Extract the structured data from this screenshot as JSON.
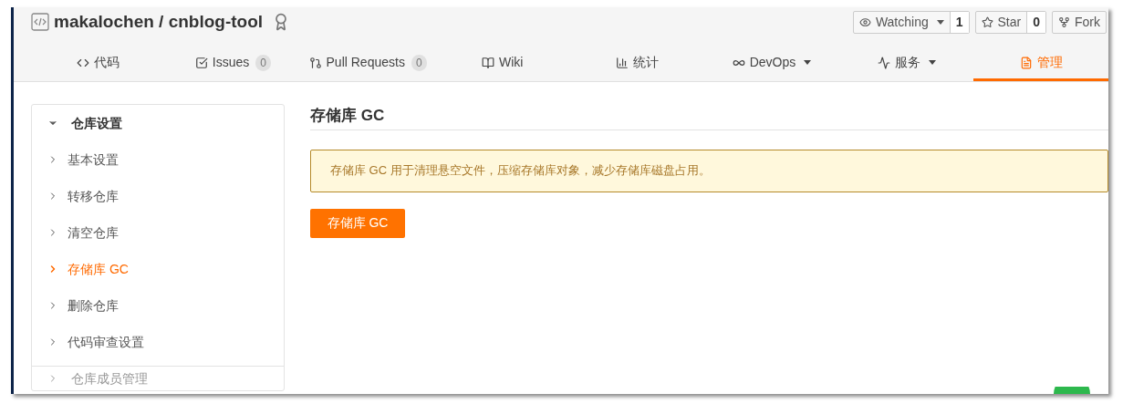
{
  "repo": {
    "title": "makalochen / cnblog-tool"
  },
  "repo_actions": [
    {
      "kind": "watch",
      "label": "Watching",
      "count": "1",
      "dropdown": true
    },
    {
      "kind": "star",
      "label": "Star",
      "count": "0",
      "dropdown": false
    },
    {
      "kind": "fork",
      "label": "Fork",
      "dropdown": false
    }
  ],
  "tabs": [
    {
      "kind": "code",
      "label": "代码",
      "selected": false,
      "dropdown": false
    },
    {
      "kind": "issues",
      "label": "Issues",
      "count": "0",
      "selected": false,
      "dropdown": false
    },
    {
      "kind": "pulls",
      "label": "Pull Requests",
      "count": "0",
      "selected": false,
      "dropdown": false
    },
    {
      "kind": "wiki",
      "label": "Wiki",
      "selected": false,
      "dropdown": false
    },
    {
      "kind": "stats",
      "label": "统计",
      "selected": false,
      "dropdown": false
    },
    {
      "kind": "devops",
      "label": "DevOps",
      "selected": false,
      "dropdown": true
    },
    {
      "kind": "service",
      "label": "服务",
      "selected": false,
      "dropdown": true
    },
    {
      "kind": "manage",
      "label": "管理",
      "selected": true,
      "dropdown": false
    }
  ],
  "sidebar": {
    "section": {
      "label": "仓库设置",
      "expanded": true,
      "children": [
        {
          "label": "基本设置",
          "selected": false
        },
        {
          "label": "转移仓库",
          "selected": false
        },
        {
          "label": "清空仓库",
          "selected": false
        },
        {
          "label": "存储库 GC",
          "selected": true
        },
        {
          "label": "删除仓库",
          "selected": false
        },
        {
          "label": "代码审查设置",
          "selected": false
        }
      ]
    },
    "next_section": {
      "label": "仓库成员管理",
      "expanded": false
    }
  },
  "content": {
    "heading": "存储库 GC",
    "notice": "存储库 GC 用于清理悬空文件，压缩存储库对象，减少存储库磁盘占用。",
    "button": "存储库 GC"
  }
}
